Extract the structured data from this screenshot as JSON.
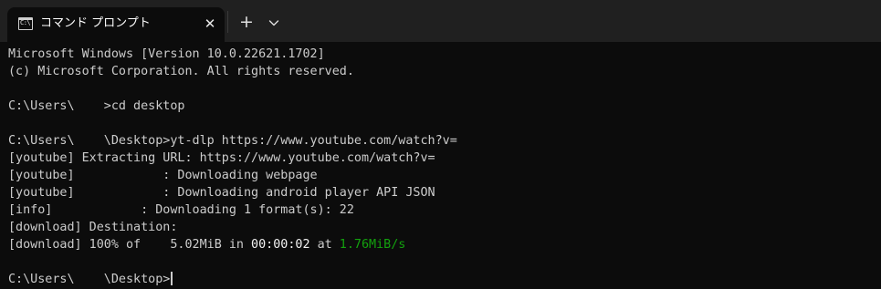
{
  "window": {
    "tab_title": "コマンド プロンプト",
    "tab_icon_text": "C:\\",
    "close_glyph": "✕",
    "new_tab_glyph": "+"
  },
  "terminal": {
    "lines": [
      "Microsoft Windows [Version 10.0.22621.1702]",
      "(c) Microsoft Corporation. All rights reserved.",
      "",
      "C:\\Users\\    >cd desktop",
      "",
      "C:\\Users\\    \\Desktop>yt-dlp https://www.youtube.com/watch?v=",
      "[youtube] Extracting URL: https://www.youtube.com/watch?v=",
      "[youtube]            : Downloading webpage",
      "[youtube]            : Downloading android player API JSON",
      "[info]            : Downloading 1 format(s): 22",
      "[download] Destination:"
    ],
    "progress_line": {
      "prefix": "[download] 100% of    5.02MiB in ",
      "elapsed": "00:00:02",
      "middle": " at ",
      "speed": "1.76MiB/s"
    },
    "prompt_final": "C:\\Users\\    \\Desktop>"
  },
  "colors": {
    "background": "#0c0c0c",
    "titlebar": "#202020",
    "text": "#cccccc",
    "speed_green": "#13a10e"
  }
}
